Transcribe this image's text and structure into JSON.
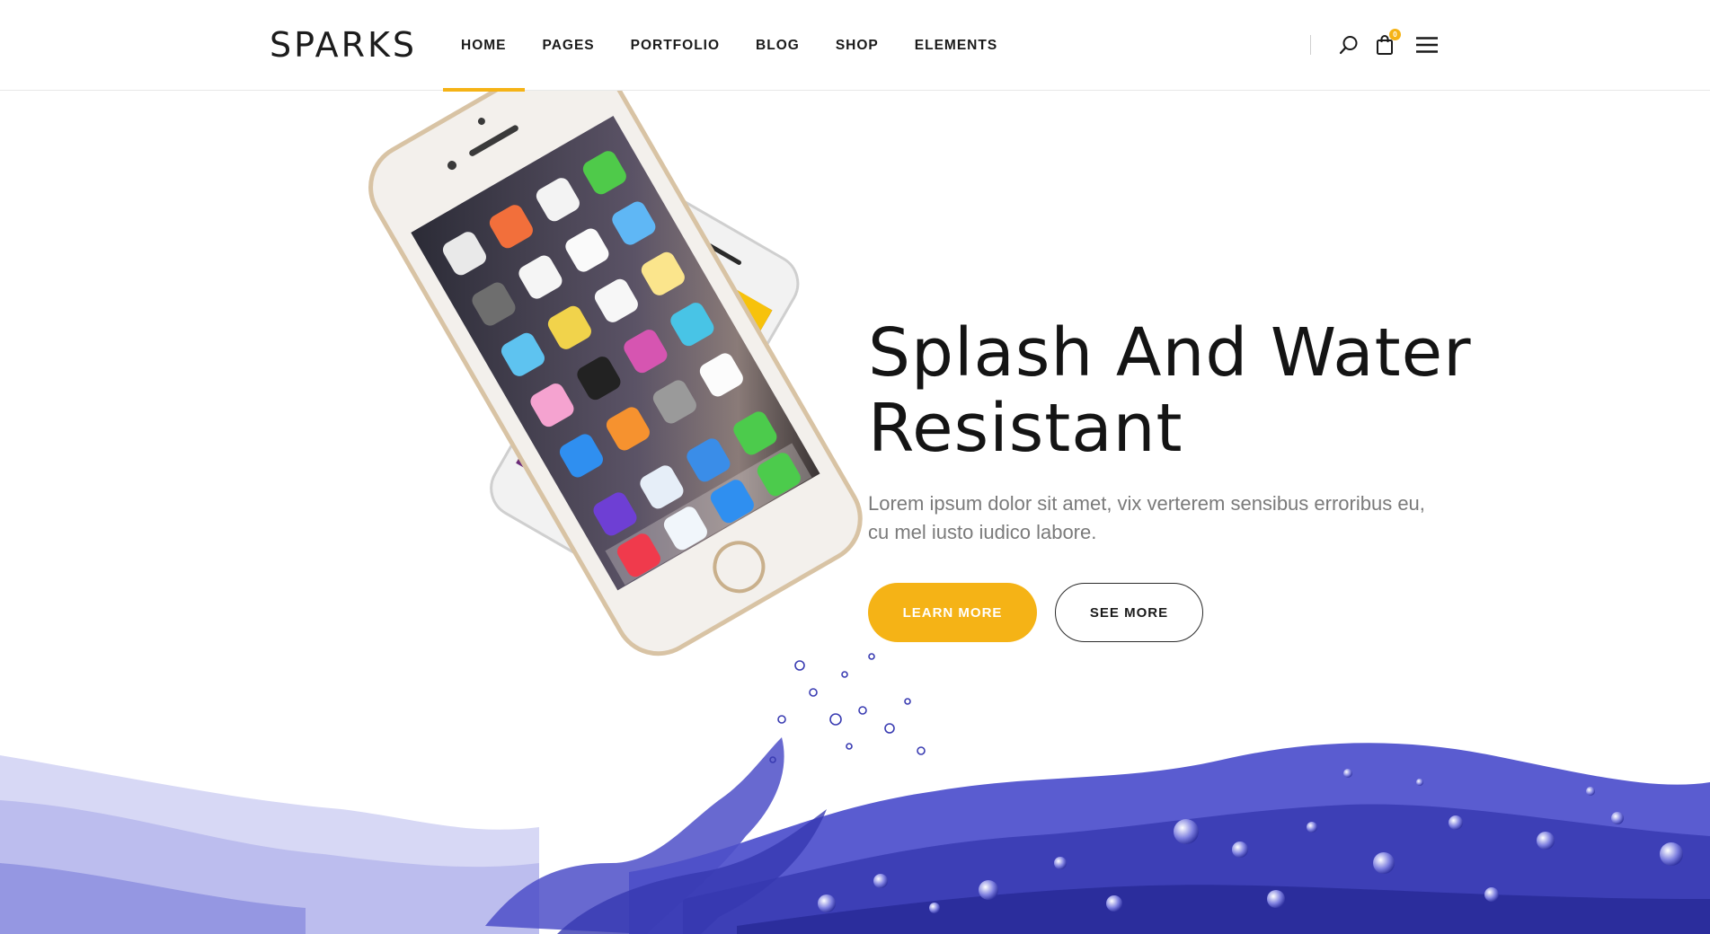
{
  "colors": {
    "accent": "#f5b316",
    "text_dark": "#141414",
    "text_muted": "#7a7a7a",
    "water_blue": "#3d3fb6"
  },
  "brand": {
    "logo_text": "SPARKS"
  },
  "nav": {
    "items": [
      {
        "label": "HOME",
        "active": true
      },
      {
        "label": "PAGES",
        "active": false
      },
      {
        "label": "PORTFOLIO",
        "active": false
      },
      {
        "label": "BLOG",
        "active": false
      },
      {
        "label": "SHOP",
        "active": false
      },
      {
        "label": "ELEMENTS",
        "active": false
      }
    ]
  },
  "header_tools": {
    "search_icon": "search-icon",
    "cart_icon": "shopping-bag-icon",
    "cart_count": "0",
    "menu_icon": "hamburger-menu-icon"
  },
  "hero": {
    "title_line1": "Splash And Water",
    "title_line2": "Resistant",
    "description": "Lorem ipsum dolor sit amet, vix verterem sensibus erroribus eu, cu mel iusto iudico labore.",
    "primary_button": "LEARN MORE",
    "secondary_button": "SEE MORE"
  }
}
